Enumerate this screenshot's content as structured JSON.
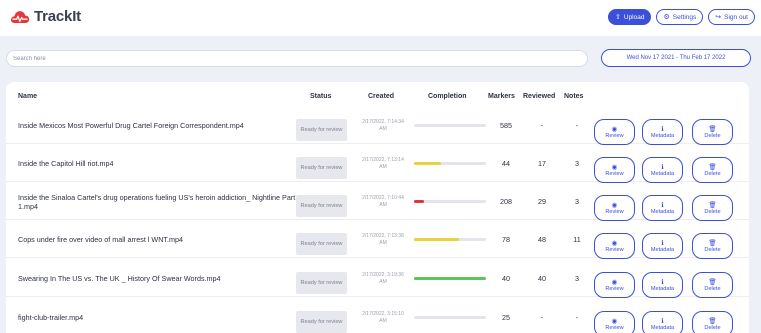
{
  "app": {
    "title": "TrackIt"
  },
  "toolbar": {
    "upload_label": "Upload",
    "upload_icon": "upload-icon",
    "settings_label": "Settings",
    "settings_icon": "gear-icon",
    "signout_label": "Sign out",
    "signout_icon": "sign-out-icon"
  },
  "search": {
    "placeholder": "Search here"
  },
  "date_range": "Wed Nov 17 2021 - Thu Feb 17 2022",
  "table": {
    "headers": {
      "name": "Name",
      "status": "Status",
      "created": "Created",
      "completion": "Completion",
      "markers": "Markers",
      "reviewed": "Reviewed",
      "notes": "Notes"
    },
    "action_labels": {
      "review": "Review",
      "metadata": "Metadata",
      "delete": "Delete"
    },
    "rows": [
      {
        "name": "Inside Mexicos Most Powerful Drug Cartel Foreign Correspondent.mp4",
        "status": "Ready for review",
        "created_date": "2/17/2022, 7:14:34",
        "created_ampm": "AM",
        "completion": 0,
        "completion_color": "#d63a3a",
        "markers": "585",
        "reviewed": "-",
        "notes": "-"
      },
      {
        "name": "Inside the Capitol Hill riot.mp4",
        "status": "Ready for review",
        "created_date": "2/17/2022, 7:13:14",
        "created_ampm": "AM",
        "completion": 0.38,
        "completion_color": "#e9d23b",
        "markers": "44",
        "reviewed": "17",
        "notes": "3"
      },
      {
        "name": "Inside the Sinaloa Cartel's drug operations fueling US's heroin addiction_ Nightline Part 1.mp4",
        "status": "Ready for review",
        "created_date": "2/17/2022, 7:10:44",
        "created_ampm": "AM",
        "completion": 0.14,
        "completion_color": "#d63a3a",
        "markers": "208",
        "reviewed": "29",
        "notes": "3"
      },
      {
        "name": "Cops under fire over video of mall arrest l WNT.mp4",
        "status": "Ready for review",
        "created_date": "2/17/2022, 7:13:38",
        "created_ampm": "AM",
        "completion": 0.62,
        "completion_color": "#e9d23b",
        "markers": "78",
        "reviewed": "48",
        "notes": "11"
      },
      {
        "name": "Swearing In The US vs. The UK _ History Of Swear Words.mp4",
        "status": "Ready for review",
        "created_date": "2/17/2022, 3:19:36",
        "created_ampm": "AM",
        "completion": 1.0,
        "completion_color": "#5cc45a",
        "markers": "40",
        "reviewed": "40",
        "notes": "3"
      },
      {
        "name": "fight-club-trailer.mp4",
        "status": "Ready for review",
        "created_date": "2/17/2022, 3:15:10",
        "created_ampm": "AM",
        "completion": 0,
        "completion_color": "#d63a3a",
        "markers": "25",
        "reviewed": "-",
        "notes": "-"
      }
    ]
  }
}
